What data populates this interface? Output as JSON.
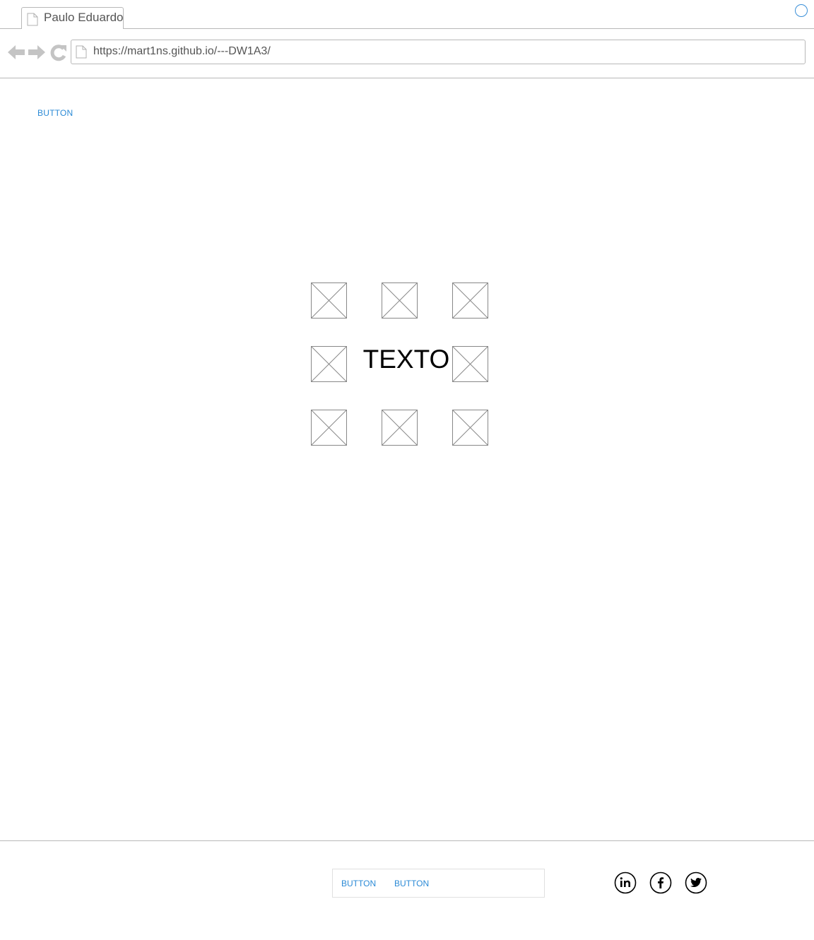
{
  "browser": {
    "tab": {
      "title": "Paulo Eduardo",
      "icon": "page-icon"
    },
    "address": {
      "url": "https://mart1ns.github.io/---DW1A3/",
      "icon": "page-icon"
    },
    "nav": {
      "back_icon": "arrow-left-icon",
      "forward_icon": "arrow-right-icon",
      "reload_icon": "reload-icon"
    },
    "status_icon": "circle-icon"
  },
  "page": {
    "top_button_label": "BUTTON",
    "center_text": "TEXTO",
    "image_placeholders": 8
  },
  "footer": {
    "buttons": [
      {
        "label": "BUTTON"
      },
      {
        "label": "BUTTON"
      }
    ],
    "social": [
      {
        "name": "linkedin",
        "icon": "linkedin-icon"
      },
      {
        "name": "facebook",
        "icon": "facebook-icon"
      },
      {
        "name": "twitter",
        "icon": "twitter-icon"
      }
    ]
  },
  "colors": {
    "accent": "#2b8ad6",
    "chrome_border": "#b8b8b8",
    "chrome_icon": "#c4c4c4",
    "placeholder_stroke": "#888888"
  }
}
